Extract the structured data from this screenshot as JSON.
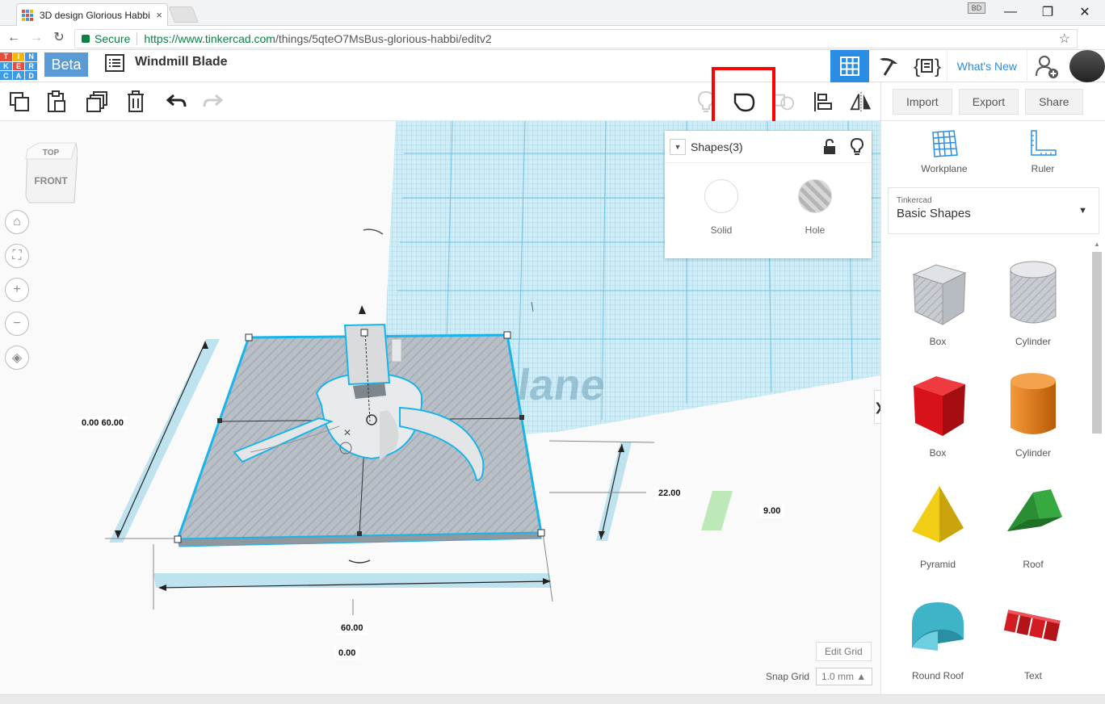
{
  "browser": {
    "tab_title": "3D design Glorious Habbi",
    "tab_close": "×",
    "profile_indicator": "BD",
    "win_minimize": "—",
    "win_restore": "❐",
    "win_close": "✕",
    "back": "←",
    "forward": "→",
    "reload": "↻",
    "secure_label": "Secure",
    "url_host": "https://www.tinkercad.com",
    "url_path": "/things/5qteO7MsBus-glorious-habbi/editv2",
    "star": "☆",
    "menu": "⋮"
  },
  "app": {
    "logo_letters": [
      "T",
      "I",
      "N",
      "K",
      "E",
      "R",
      "C",
      "A",
      "D"
    ],
    "beta_label": "Beta",
    "design_title": "Windmill Blade",
    "whats_new": "What's New"
  },
  "toolbar": {
    "actions": [
      "Import",
      "Export",
      "Share"
    ]
  },
  "viewcube": {
    "top": "TOP",
    "front": "FRONT"
  },
  "nav_controls": {
    "home": "⌂",
    "fit": "⛶",
    "zoom_in": "+",
    "zoom_out": "−",
    "ortho": "◈"
  },
  "canvas": {
    "workplane_watermark": "Workplane",
    "dimensions": {
      "left_pair_a": "0.00",
      "left_pair_b": "60.00",
      "height": "22.00",
      "elevation": "9.00",
      "width": "60.00",
      "origin": "0.00"
    },
    "edit_grid": "Edit Grid",
    "snap_label": "Snap Grid",
    "snap_value": "1.0 mm ▲",
    "panel_toggle": "❯"
  },
  "shapes_panel": {
    "caret": "▼",
    "title": "Shapes(3)",
    "options": [
      {
        "label": "Solid",
        "color": "#ffffff"
      },
      {
        "label": "Hole",
        "color": "#bdbdbd"
      }
    ]
  },
  "sidebar": {
    "tools": [
      {
        "label": "Workplane",
        "icon": "workplane-icon"
      },
      {
        "label": "Ruler",
        "icon": "ruler-icon"
      }
    ],
    "library_small": "Tinkercad",
    "library_name": "Basic Shapes",
    "library_caret": "▼",
    "shapes": [
      {
        "label": "Box",
        "color": "#c4cad2"
      },
      {
        "label": "Cylinder",
        "color": "#c4cad2"
      },
      {
        "label": "Box",
        "color": "#d8121a"
      },
      {
        "label": "Cylinder",
        "color": "#e8790f"
      },
      {
        "label": "Pyramid",
        "color": "#f2cd16"
      },
      {
        "label": "Roof",
        "color": "#2fa23a"
      },
      {
        "label": "Round Roof",
        "color": "#3fb4c8"
      },
      {
        "label": "Text",
        "color": "#d11d22"
      }
    ]
  },
  "colors": {
    "accent": "#2a8de3",
    "grid": "#7fcbe8",
    "selection": "#19b5e8",
    "highlight": "#ff0000"
  }
}
